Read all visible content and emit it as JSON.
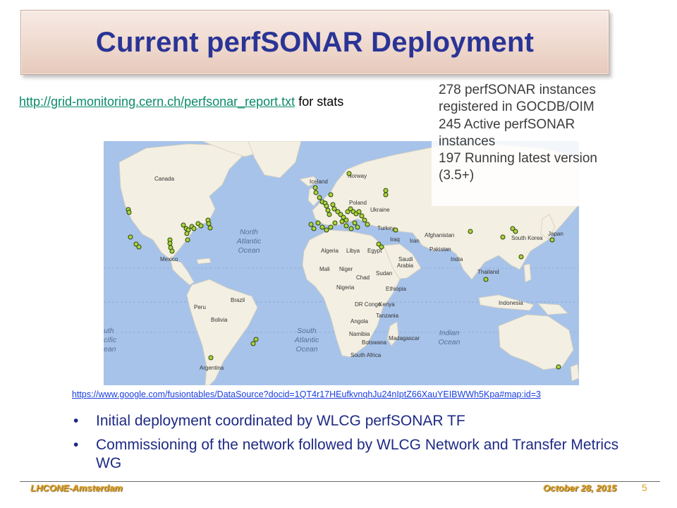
{
  "slide": {
    "title": "Current perfSONAR Deployment",
    "report_link": "http://grid-monitoring.cern.ch/perfsonar_report.txt",
    "report_suffix": " for stats",
    "stats": [
      "278 perfSONAR instances",
      "registered in GOCDB/OIM",
      "245 Active perfSONAR",
      "instances",
      "197 Running latest version",
      "(3.5+)"
    ],
    "source_url": "https://www.google.com/fusiontables/DataSource?docid=1QT4r17HEufkvnqhJu24nIptZ66XauYEIBWWh5Kpa#map:id=3",
    "bullets": [
      "Initial deployment coordinated by WLCG perfSONAR TF",
      "Commissioning of the network followed by WLCG Network and Transfer Metrics WG"
    ],
    "bullet_glyph": "•"
  },
  "map": {
    "labels": {
      "canada": "Canada",
      "mexico": "Mexico",
      "north_atlantic_1": "North",
      "north_atlantic_2": "Atlantic",
      "north_atlantic_3": "Ocean",
      "south_atlantic_1": "South",
      "south_atlantic_2": "Atlantic",
      "south_atlantic_3": "Ocean",
      "indian_1": "Indian",
      "indian_2": "Ocean",
      "pacific_1": "uth",
      "pacific_2": "cific",
      "pacific_3": "ean",
      "iceland": "Iceland",
      "norway": "Norway",
      "poland": "Poland",
      "ukraine": "Ukraine",
      "turkey": "Turkey",
      "algeria": "Algeria",
      "libya": "Libya",
      "egypt": "Egypt",
      "iraq": "Iraq",
      "iran": "Iran",
      "afghanistan": "Afghanistan",
      "pakistan": "Pakistan",
      "india": "India",
      "mali": "Mali",
      "niger": "Niger",
      "chad": "Chad",
      "sudan": "Sudan",
      "nigeria": "Nigeria",
      "ethiopia": "Ethiopia",
      "saudi_arabia_1": "Saudi",
      "saudi_arabia_2": "Arabia",
      "dr_congo": "DR Congo",
      "kenya": "Kenya",
      "tanzania": "Tanzania",
      "angola": "Angola",
      "namibia": "Namibia",
      "botswana": "Botswana",
      "madagascar": "Madagascar",
      "south_africa": "South Africa",
      "thailand": "Thailand",
      "south_korea": "South Korea",
      "japan": "Japan",
      "indonesia": "Indonesia",
      "peru": "Peru",
      "brazil": "Brazil",
      "bolivia": "Bolivia",
      "argentina": "Argentina"
    },
    "marker_color": "#a9d63a",
    "ocean_color": "#a7c3ea",
    "land_color": "#f3efe2"
  },
  "footer": {
    "left": "LHCONE-Amsterdam",
    "right": "October 28, 2015",
    "page": "5"
  }
}
